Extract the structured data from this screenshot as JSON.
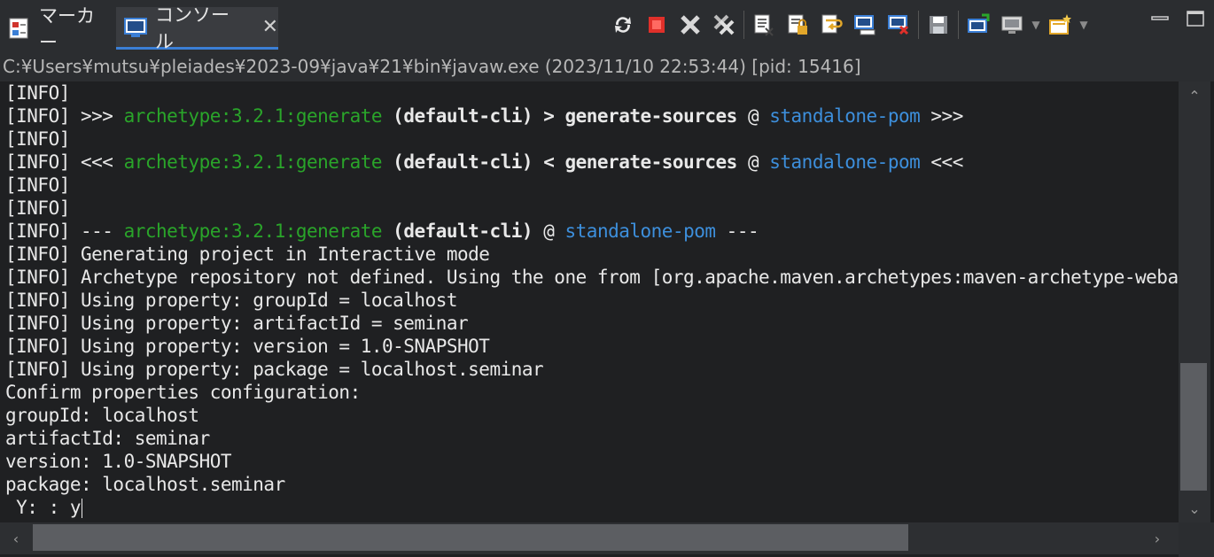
{
  "tabs": {
    "markers_label": "マーカー",
    "console_label": "コンソール",
    "console_close": "✕"
  },
  "path": {
    "text": "C:¥Users¥mutsu¥pleiades¥2023-09¥java¥21¥bin¥javaw.exe (2023/11/10 22:53:44) [pid: 15416]"
  },
  "console": {
    "lines": [
      "[INFO]",
      "[INFO] >>> ",
      "[INFO]",
      "[INFO] <<< ",
      "[INFO]",
      "[INFO]",
      "[INFO] --- ",
      "[INFO] Generating project in Interactive mode",
      "[INFO] Archetype repository not defined. Using the one from [org.apache.maven.archetypes:maven-archetype-webapp",
      "[INFO] Using property: groupId = localhost",
      "[INFO] Using property: artifactId = seminar",
      "[INFO] Using property: version = 1.0-SNAPSHOT",
      "[INFO] Using property: package = localhost.seminar",
      "Confirm properties configuration:",
      "groupId: localhost",
      "artifactId: seminar",
      "version: 1.0-SNAPSHOT",
      "package: localhost.seminar",
      " Y: : y"
    ],
    "goal": "archetype:3.2.1:generate",
    "cli": "(default-cli)",
    "phase_in": "> generate-sources",
    "phase_out": "< generate-sources",
    "at": "@",
    "project": "standalone-pom",
    "suffix_in": " >>>",
    "suffix_out": " <<<",
    "suffix_dash": " ---"
  },
  "colors": {
    "background": "#1f2022",
    "text": "#e8e8e8",
    "goal": "#2aa52a",
    "project": "#3d8fdc"
  }
}
